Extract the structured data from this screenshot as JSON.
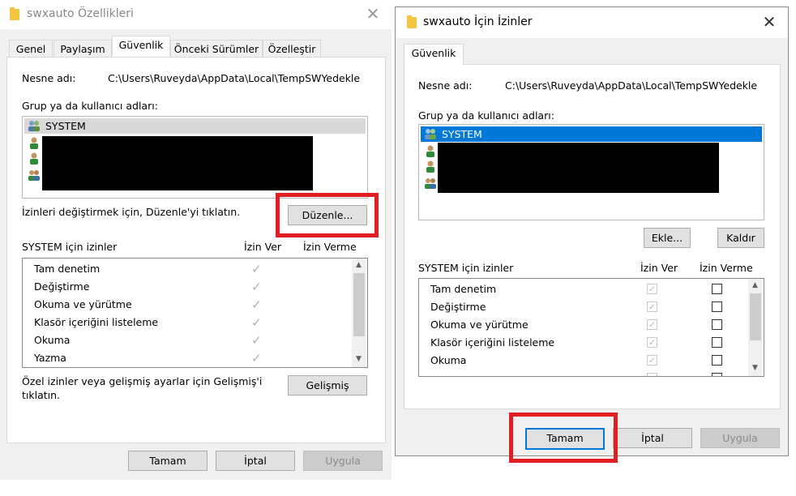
{
  "left_window": {
    "title": "swxauto Özellikleri",
    "tabs": [
      "Genel",
      "Paylaşım",
      "Güvenlik",
      "Önceki Sürümler",
      "Özelleştir"
    ],
    "active_tab": "Güvenlik",
    "object_label": "Nesne adı:",
    "object_value": "C:\\Users\\Ruveyda\\AppData\\Local\\TempSWYedekle",
    "group_label": "Grup ya da kullanıcı adları:",
    "users": [
      "SYSTEM"
    ],
    "change_hint": "İzinleri değiştirmek için, Düzenle'yi tıklatın.",
    "edit_button": "Düzenle...",
    "perm_header": "SYSTEM için izinler",
    "allow_header": "İzin Ver",
    "deny_header": "İzin Verme",
    "permissions": [
      "Tam denetim",
      "Değiştirme",
      "Okuma ve yürütme",
      "Klasör içeriğini listeleme",
      "Okuma",
      "Yazma"
    ],
    "special_hint_line1": "Özel izinler veya gelişmiş ayarlar için Gelişmiş'i",
    "special_hint_line2": "tıklatın.",
    "advanced_button": "Gelişmiş",
    "ok_button": "Tamam",
    "cancel_button": "İptal",
    "apply_button": "Uygula"
  },
  "right_window": {
    "title": "swxauto İçin İzinler",
    "tabs": [
      "Güvenlik"
    ],
    "object_label": "Nesne adı:",
    "object_value": "C:\\Users\\Ruveyda\\AppData\\Local\\TempSWYedekle",
    "group_label": "Grup ya da kullanıcı adları:",
    "users": [
      "SYSTEM"
    ],
    "add_button": "Ekle...",
    "remove_button": "Kaldır",
    "perm_header": "SYSTEM için izinler",
    "allow_header": "İzin Ver",
    "deny_header": "İzin Verme",
    "permissions": [
      "Tam denetim",
      "Değiştirme",
      "Okuma ve yürütme",
      "Klasör içeriğini listeleme",
      "Okuma"
    ],
    "ok_button": "Tamam",
    "cancel_button": "İptal",
    "apply_button": "Uygula"
  },
  "colors": {
    "highlight_box": "#e01e24",
    "selection": "#0078d7",
    "dialog_bg": "#f0f0f0"
  }
}
